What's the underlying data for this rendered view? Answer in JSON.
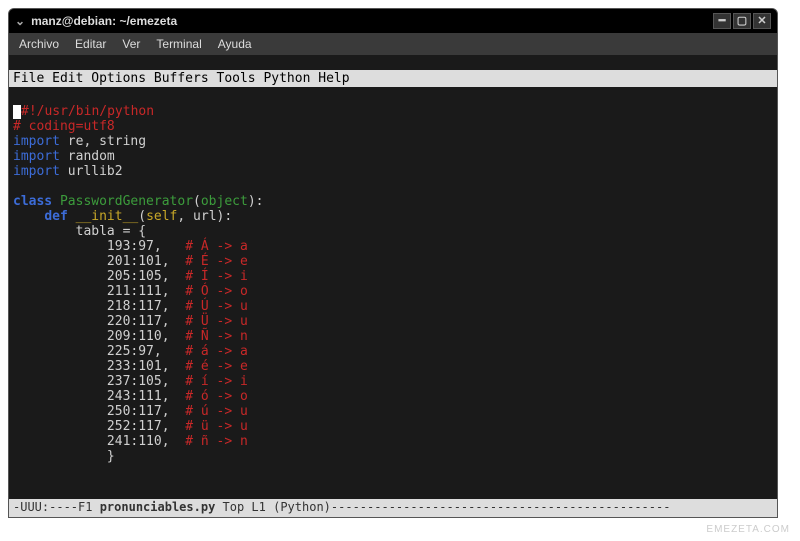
{
  "titlebar": {
    "title": "manz@debian: ~/emezeta"
  },
  "menubar": {
    "items": [
      "Archivo",
      "Editar",
      "Ver",
      "Terminal",
      "Ayuda"
    ]
  },
  "emacs_menu": "File Edit Options Buffers Tools Python Help",
  "code": {
    "l1": "#!/usr/bin/python",
    "l2": "# coding=utf8",
    "l3a": "import",
    "l3b": " re, string",
    "l4a": "import",
    "l4b": " random",
    "l5a": "import",
    "l5b": " urllib2",
    "l6a": "class",
    "l6b": "PasswordGenerator",
    "l6c": "object",
    "l7a": "def",
    "l7b": "__init__",
    "l7c": "self",
    "l7d": ", url):",
    "l8": "        tabla = {",
    "rows": [
      {
        "kv": "            193:97,   ",
        "cmt": "# Á -> a"
      },
      {
        "kv": "            201:101,  ",
        "cmt": "# É -> e"
      },
      {
        "kv": "            205:105,  ",
        "cmt": "# Í -> i"
      },
      {
        "kv": "            211:111,  ",
        "cmt": "# Ó -> o"
      },
      {
        "kv": "            218:117,  ",
        "cmt": "# Ú -> u"
      },
      {
        "kv": "            220:117,  ",
        "cmt": "# Ü -> u"
      },
      {
        "kv": "            209:110,  ",
        "cmt": "# Ñ -> n"
      },
      {
        "kv": "            225:97,   ",
        "cmt": "# á -> a"
      },
      {
        "kv": "            233:101,  ",
        "cmt": "# é -> e"
      },
      {
        "kv": "            237:105,  ",
        "cmt": "# í -> i"
      },
      {
        "kv": "            243:111,  ",
        "cmt": "# ó -> o"
      },
      {
        "kv": "            250:117,  ",
        "cmt": "# ú -> u"
      },
      {
        "kv": "            252:117,  ",
        "cmt": "# ü -> u"
      },
      {
        "kv": "            241:110,  ",
        "cmt": "# ñ -> n"
      }
    ],
    "l_end": "            }"
  },
  "statusbar": {
    "left": "-UUU:----F1  ",
    "file": "pronunciables.py",
    "pos": "   Top L1     (Python)",
    "dashes": "-----------------------------------------------"
  },
  "watermark": "EMEZETA.COM"
}
